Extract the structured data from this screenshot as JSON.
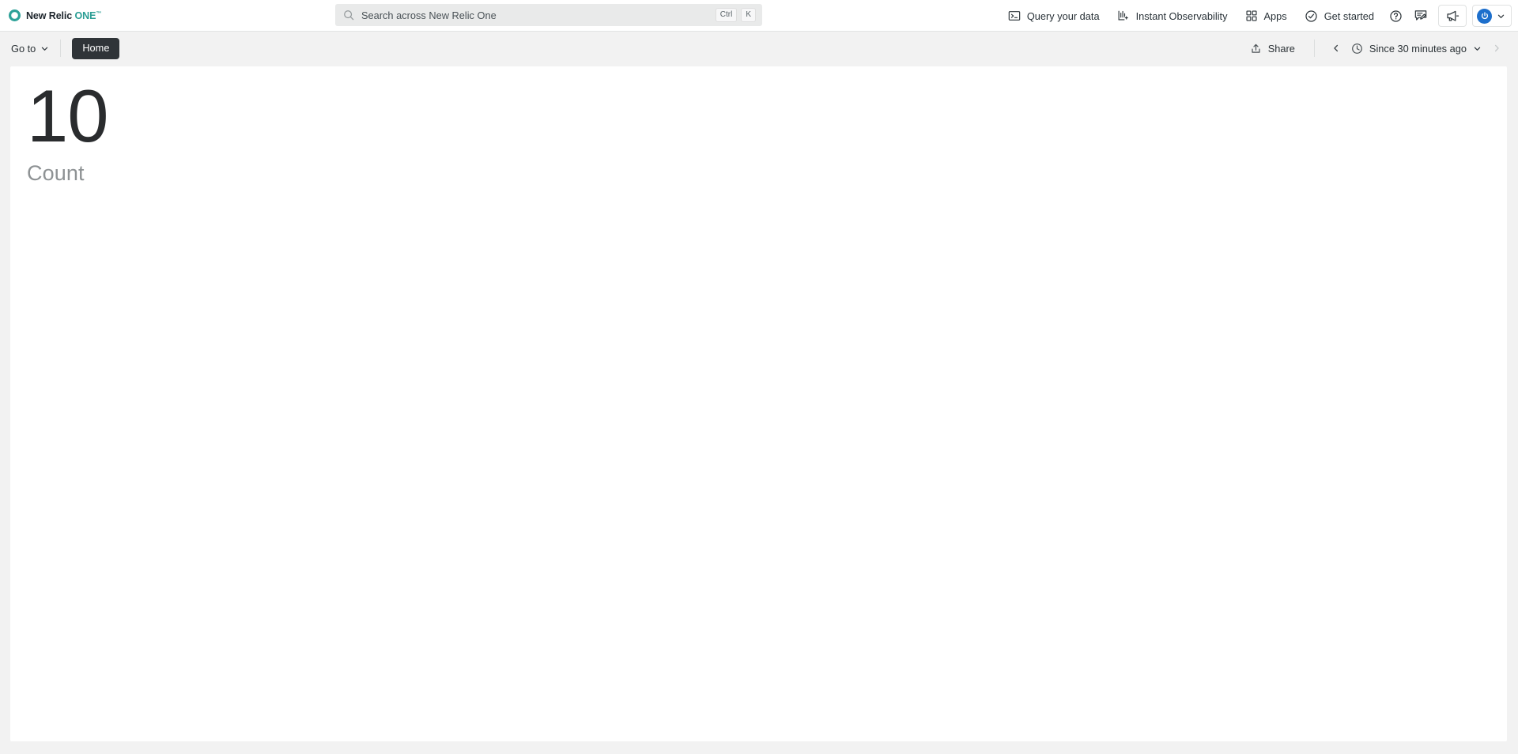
{
  "brand": {
    "name": "New Relic",
    "product": "ONE",
    "trademark": "™",
    "logo_icon": "new-relic-circle-logo",
    "accent_color": "#2A9D94"
  },
  "search": {
    "placeholder": "Search across New Relic One",
    "value": "",
    "icon": "search-icon",
    "shortcut_keys": [
      "Ctrl",
      "K"
    ]
  },
  "top_nav": {
    "items": [
      {
        "label": "Query your data",
        "icon": "terminal-icon"
      },
      {
        "label": "Instant Observability",
        "icon": "bar-chart-plus-icon"
      },
      {
        "label": "Apps",
        "icon": "grid-apps-icon"
      },
      {
        "label": "Get started",
        "icon": "check-circle-icon"
      }
    ],
    "icon_buttons": [
      {
        "name": "help-icon",
        "label": "Help"
      },
      {
        "name": "feedback-icon",
        "label": "Feedback"
      },
      {
        "name": "megaphone-icon",
        "label": "Announcements"
      }
    ],
    "account": {
      "avatar_icon": "power-avatar-icon",
      "avatar_color": "#1D6FCC",
      "chevron": "chevron-down-icon"
    }
  },
  "toolbar": {
    "goto_label": "Go to",
    "goto_chevron": "chevron-down-icon",
    "home_label": "Home",
    "share_label": "Share",
    "share_icon": "share-upload-icon",
    "prev_icon": "chevron-left-icon",
    "next_icon": "chevron-right-icon",
    "time_range": {
      "icon": "clock-icon",
      "label": "Since 30 minutes ago",
      "chevron": "chevron-down-icon"
    }
  },
  "main": {
    "billboard": {
      "value": "10",
      "label": "Count"
    }
  }
}
